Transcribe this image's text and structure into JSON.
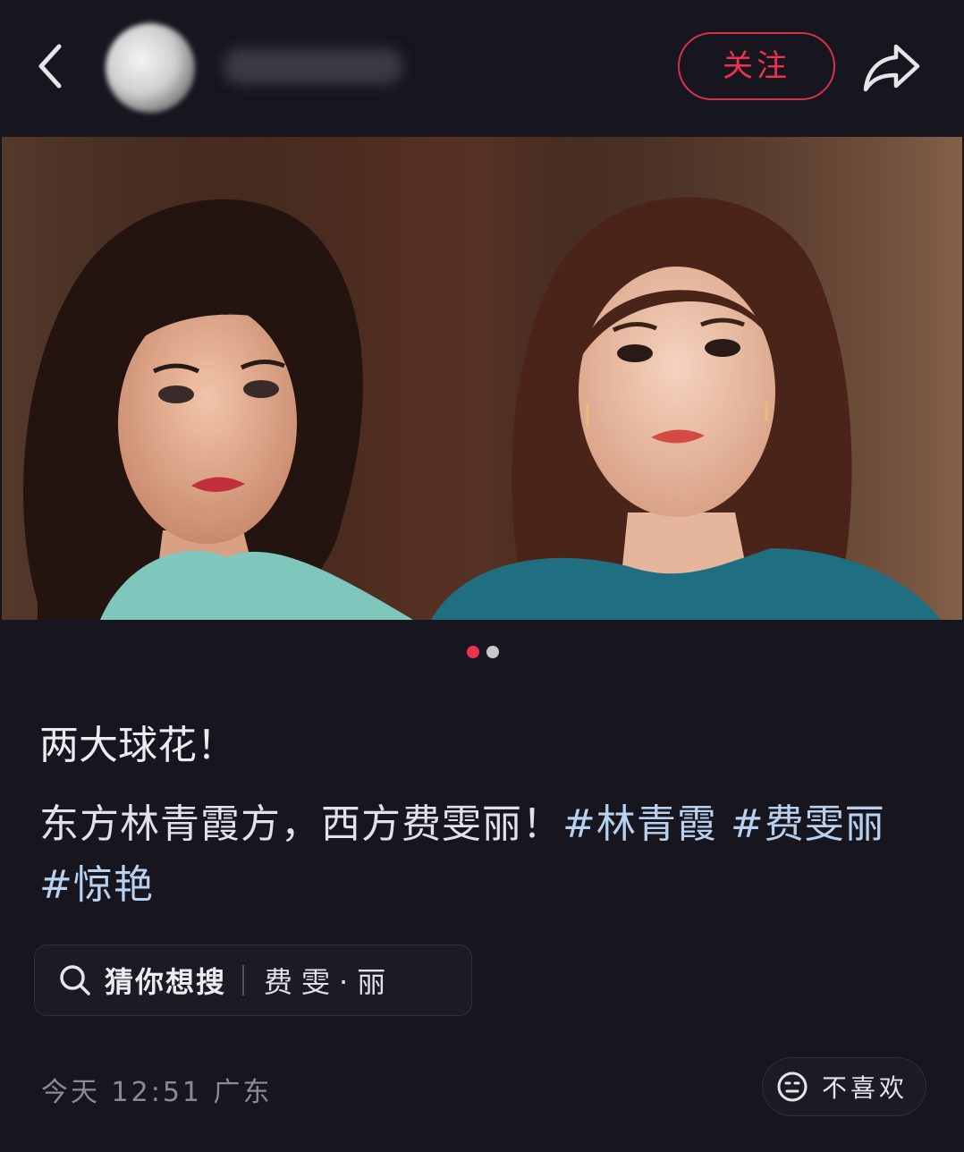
{
  "header": {
    "follow_label": "关注"
  },
  "carousel": {
    "total": 2,
    "active_index": 0,
    "active_color": "#e8344f",
    "inactive_color": "#c8c8cc"
  },
  "post": {
    "title": "两大球花！",
    "body_text": "东方林青霞方，西方费雯丽！",
    "hashtags": [
      "#林青霞",
      "#费雯丽",
      "#惊艳"
    ]
  },
  "search_suggest": {
    "label": "猜你想搜",
    "term": "费雯·丽"
  },
  "meta": {
    "time": "今天 12:51",
    "location": "广东"
  },
  "dislike_label": "不喜欢",
  "colors": {
    "background": "#17161f",
    "accent": "#e8344f",
    "hashtag": "#b9d1ef"
  },
  "icons": [
    "back-icon",
    "share-icon",
    "search-icon",
    "neutral-face-icon"
  ]
}
